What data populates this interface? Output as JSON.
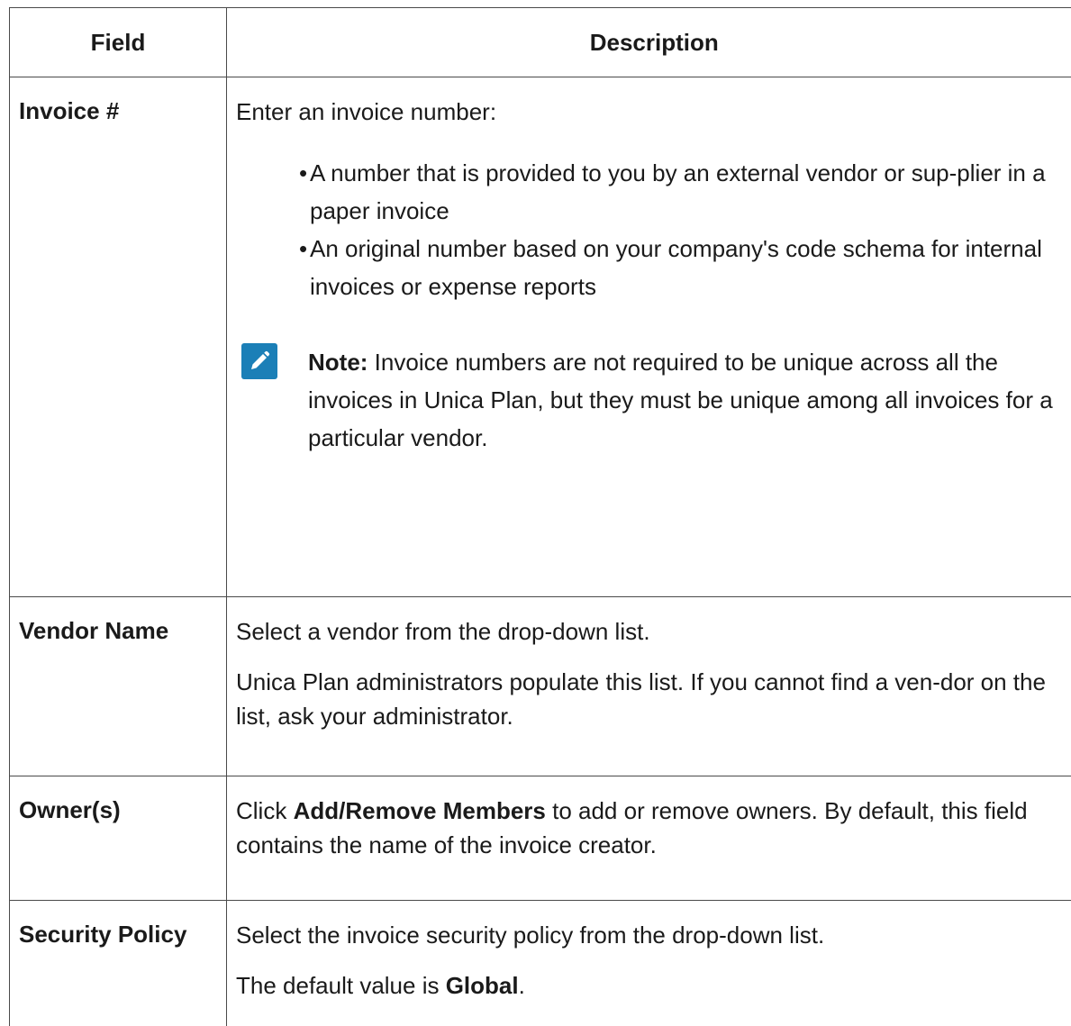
{
  "table": {
    "headers": {
      "field": "Field",
      "description": "Description"
    },
    "rows": {
      "invoice": {
        "field": "Invoice #",
        "intro": "Enter an invoice number:",
        "bullets": [
          "A number that is provided to you by an external vendor or sup-plier in a paper invoice",
          "An original number based on your company's code schema for internal invoices or expense reports"
        ],
        "note_label": "Note:",
        "note_text": "Invoice numbers are not required to be unique across all the invoices in Unica Plan, but they must be unique among all invoices for a particular vendor.",
        "note_icon": "pencil-note-icon",
        "note_icon_color": "#1b7fb7"
      },
      "vendor": {
        "field": "Vendor Name",
        "para1": "Select a vendor from the drop-down list.",
        "para2": "Unica Plan administrators populate this list. If you cannot find a ven-dor on the list, ask your administrator."
      },
      "owner": {
        "field": "Owner(s)",
        "pre": "Click ",
        "bold": "Add/Remove Members",
        "post": " to add or remove owners. By default, this field contains the name of the invoice creator."
      },
      "security": {
        "field": "Security Policy",
        "para1": "Select the invoice security policy from the drop-down list.",
        "para2_pre": "The default value is ",
        "para2_bold": "Global",
        "para2_post": "."
      }
    }
  }
}
